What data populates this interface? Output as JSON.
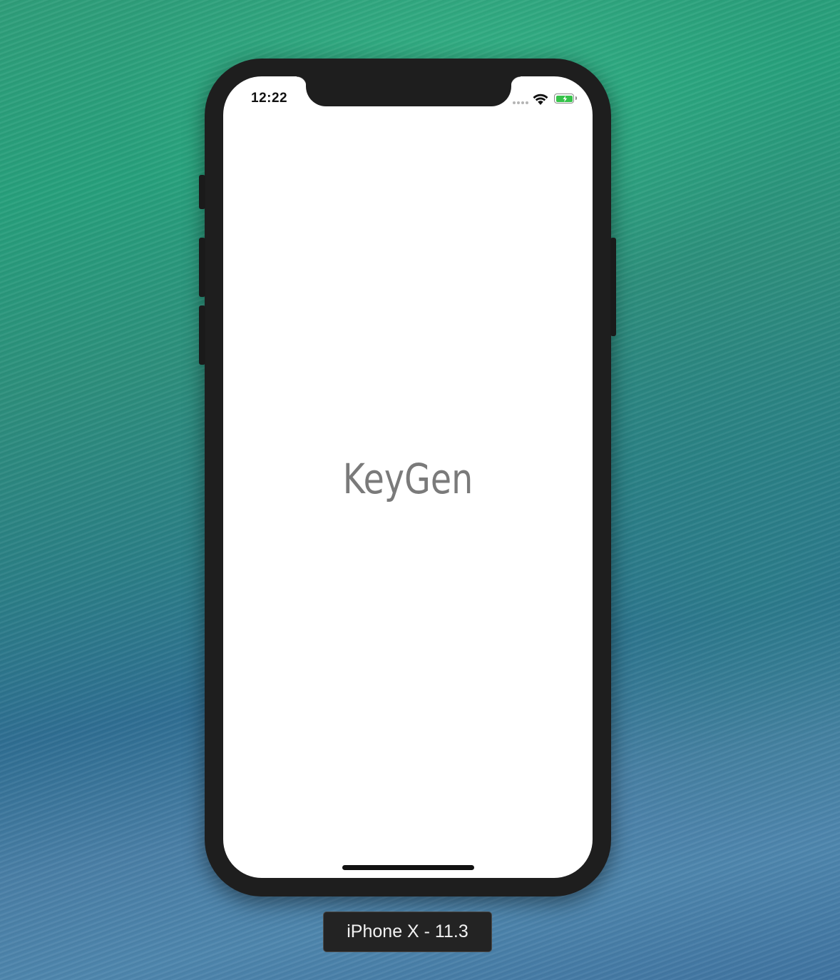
{
  "simulator": {
    "device_label": "iPhone X - 11.3"
  },
  "status_bar": {
    "time": "12:22",
    "battery_state": "charging"
  },
  "app": {
    "title": "KeyGen"
  },
  "colors": {
    "screen_background": "#ffffff",
    "title_text": "#7a7a7a",
    "device_frame": "#1e1e1e",
    "battery_fill": "#36c24a"
  },
  "icons": [
    "signal-dots-icon",
    "wifi-icon",
    "battery-charging-icon"
  ]
}
